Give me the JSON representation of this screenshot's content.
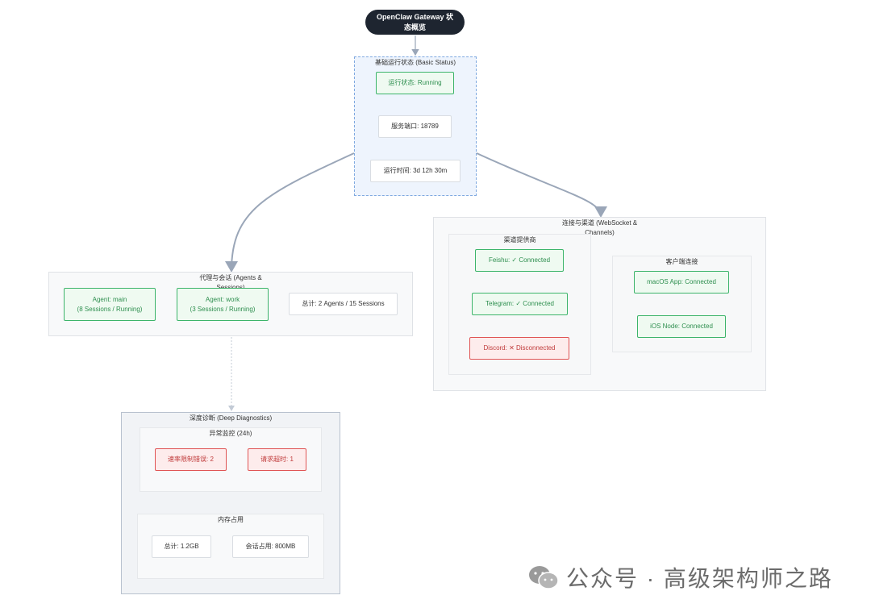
{
  "root": {
    "title": "OpenClaw Gateway 状态概览"
  },
  "basic": {
    "title": "基础运行状态 (Basic Status)",
    "status": "运行状态: Running",
    "port": "服务端口: 18789",
    "uptime": "运行时间: 3d 12h 30m"
  },
  "agents": {
    "title": "代理与会话 (Agents & Sessions)",
    "main": "Agent: main\n(8 Sessions / Running)",
    "work": "Agent: work\n(3 Sessions / Running)",
    "total": "总计: 2 Agents / 15 Sessions"
  },
  "conn": {
    "title": "连接与渠道 (WebSocket & Channels)",
    "providers": {
      "title": "渠道提供商",
      "feishu": "Feishu: ✓ Connected",
      "telegram": "Telegram: ✓ Connected",
      "discord": "Discord: ✕ Disconnected"
    },
    "clients": {
      "title": "客户端连接",
      "macos": "macOS App: Connected",
      "ios": "iOS Node: Connected"
    }
  },
  "diag": {
    "title": "深度诊断 (Deep Diagnostics)",
    "anomaly": {
      "title": "异常监控 (24h)",
      "rate": "速率限制错误: 2",
      "timeout": "请求超时: 1"
    },
    "memory": {
      "title": "内存占用",
      "total": "总计: 1.2GB",
      "session": "会话占用: 800MB"
    }
  },
  "watermark": {
    "text": "公众号 · 高级架构师之路"
  },
  "colors": {
    "root_bg": "#1e2530",
    "ok": "#3cb46a",
    "error": "#e05555",
    "edge": "#9aa6b8"
  }
}
